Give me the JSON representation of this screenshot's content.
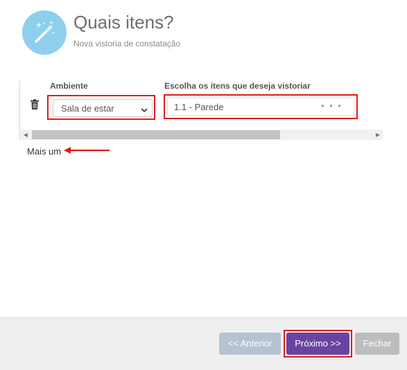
{
  "header": {
    "icon": "magic-wand-icon",
    "title": "Quais itens?",
    "subtitle": "Nova vistoria de constatação",
    "icon_bg_color": "#8fcfee"
  },
  "table": {
    "columns": [
      "Ambiente",
      "Escolha os itens que deseja vistoriar"
    ],
    "rows": [
      {
        "delete_icon": "trash-icon",
        "ambiente": "Sala de estar",
        "itens": "1.1 - Parede",
        "more_icon": "ellipsis-icon"
      }
    ]
  },
  "add_more_label": "Mais um",
  "highlight_color": "#e01b1b",
  "footer": {
    "prev_label": "<< Anterior",
    "next_label": "Próximo >>",
    "close_label": "Fechar",
    "next_color": "#6a43a0"
  }
}
